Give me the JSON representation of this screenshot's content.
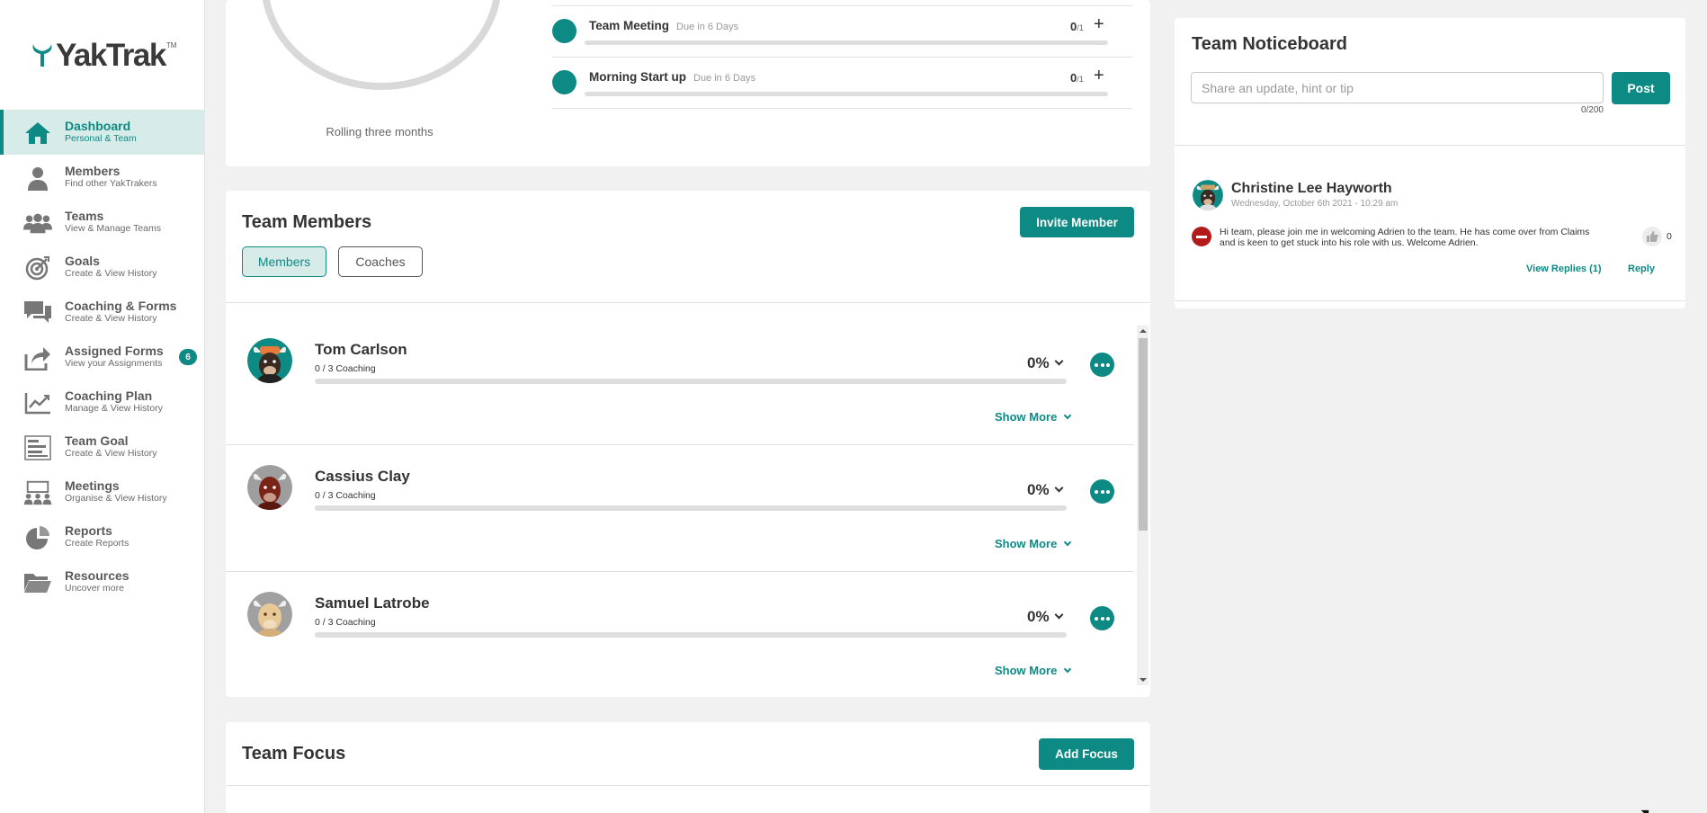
{
  "brand": {
    "logo_text": "YakTrak",
    "trademark": "TM",
    "accent": "#0e8a84"
  },
  "sidebar": {
    "items": [
      {
        "label": "Dashboard",
        "sub": "Personal & Team",
        "icon": "home-icon",
        "active": true
      },
      {
        "label": "Members",
        "sub": "Find other YakTrakers",
        "icon": "person-icon"
      },
      {
        "label": "Teams",
        "sub": "View & Manage Teams",
        "icon": "group-icon"
      },
      {
        "label": "Goals",
        "sub": "Create & View History",
        "icon": "target-icon"
      },
      {
        "label": "Coaching & Forms",
        "sub": "Create & View History",
        "icon": "chat-icon"
      },
      {
        "label": "Assigned Forms",
        "sub": "View your Assignments",
        "icon": "share-icon",
        "badge": "6"
      },
      {
        "label": "Coaching Plan",
        "sub": "Manage & View History",
        "icon": "trend-chart-icon"
      },
      {
        "label": "Team Goal",
        "sub": "Create & View History",
        "icon": "list-bars-icon"
      },
      {
        "label": "Meetings",
        "sub": "Organise & View History",
        "icon": "presentation-icon"
      },
      {
        "label": "Reports",
        "sub": "Create Reports",
        "icon": "pie-chart-icon"
      },
      {
        "label": "Resources",
        "sub": "Uncover more",
        "icon": "folder-icon"
      }
    ]
  },
  "top_card": {
    "rolling_label": "Rolling three months",
    "meetings": [
      {
        "title": "Team Meeting",
        "due": "Due in 6 Days",
        "count": "0",
        "total": "/1",
        "progress": 0
      },
      {
        "title": "Morning Start up",
        "due": "Due in 6 Days",
        "count": "0",
        "total": "/1",
        "progress": 0
      }
    ]
  },
  "team_members": {
    "title": "Team Members",
    "invite_label": "Invite Member",
    "tabs": {
      "members": "Members",
      "coaches": "Coaches"
    },
    "show_more_label": "Show More",
    "members": [
      {
        "name": "Tom Carlson",
        "coaching": "0 / 3 Coaching",
        "percent": "0%"
      },
      {
        "name": "Cassius Clay",
        "coaching": "0 / 3 Coaching",
        "percent": "0%"
      },
      {
        "name": "Samuel Latrobe",
        "coaching": "0 / 3 Coaching",
        "percent": "0%"
      }
    ]
  },
  "team_focus": {
    "title": "Team Focus",
    "add_label": "Add Focus"
  },
  "noticeboard": {
    "title": "Team Noticeboard",
    "placeholder": "Share an update, hint or tip",
    "char_count": "0/200",
    "post_label": "Post",
    "posts": [
      {
        "author": "Christine Lee Hayworth",
        "date": "Wednesday, October 6th 2021 - 10:29 am",
        "body": "Hi team, please join me in welcoming Adrien to the team. He has come over from Claims and is keen to get stuck into his role with us. Welcome Adrien.",
        "likes": "0",
        "view_replies": "View Replies (1)",
        "reply": "Reply"
      }
    ]
  }
}
